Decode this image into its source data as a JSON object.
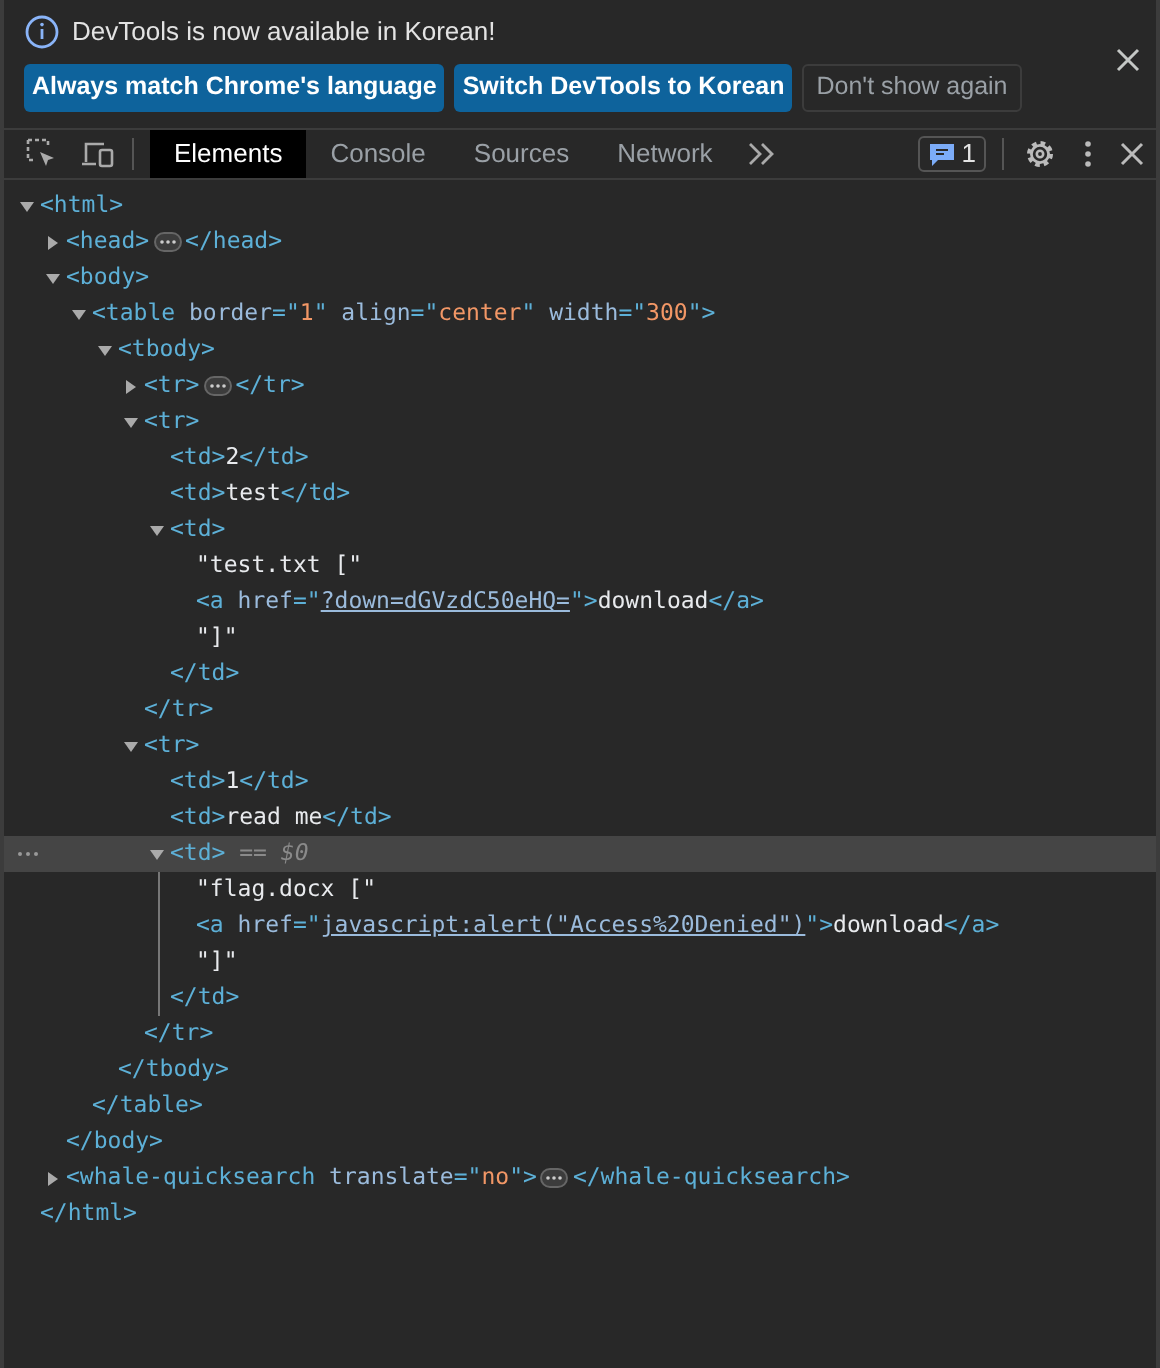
{
  "infobar": {
    "message": "DevTools is now available in Korean!",
    "buttons": [
      {
        "label": "Always match Chrome's language",
        "kind": "primary"
      },
      {
        "label": "Switch DevTools to Korean",
        "kind": "primary"
      },
      {
        "label": "Don't show again",
        "kind": "plain"
      }
    ]
  },
  "toolbar": {
    "tabs": [
      {
        "label": "Elements",
        "selected": true
      },
      {
        "label": "Console",
        "selected": false
      },
      {
        "label": "Sources",
        "selected": false
      },
      {
        "label": "Network",
        "selected": false
      }
    ],
    "issues_count": "1"
  },
  "tree": [
    {
      "selected": false,
      "expanded": true,
      "parts": [
        {
          "kind": "tag",
          "text": "<html>"
        }
      ],
      "close": [
        {
          "kind": "tag",
          "text": "</html>"
        }
      ],
      "children": [
        {
          "selected": false,
          "expanded": false,
          "parts": [
            {
              "kind": "tag",
              "text": "<head>"
            },
            {
              "kind": "ellipsis"
            },
            {
              "kind": "tag",
              "text": "</head>"
            }
          ]
        },
        {
          "selected": false,
          "expanded": true,
          "parts": [
            {
              "kind": "tag",
              "text": "<body>"
            }
          ],
          "close": [
            {
              "kind": "tag",
              "text": "</body>"
            }
          ],
          "children": [
            {
              "selected": false,
              "expanded": true,
              "parts": [
                {
                  "kind": "tag",
                  "text": "<table"
                },
                {
                  "kind": "attr",
                  "text": " border"
                },
                {
                  "kind": "tag",
                  "text": "=\""
                },
                {
                  "kind": "value",
                  "text": "1"
                },
                {
                  "kind": "tag",
                  "text": "\""
                },
                {
                  "kind": "attr",
                  "text": " align"
                },
                {
                  "kind": "tag",
                  "text": "=\""
                },
                {
                  "kind": "value",
                  "text": "center"
                },
                {
                  "kind": "tag",
                  "text": "\""
                },
                {
                  "kind": "attr",
                  "text": " width"
                },
                {
                  "kind": "tag",
                  "text": "=\""
                },
                {
                  "kind": "value",
                  "text": "300"
                },
                {
                  "kind": "tag",
                  "text": "\">"
                }
              ],
              "close": [
                {
                  "kind": "tag",
                  "text": "</table>"
                }
              ],
              "children": [
                {
                  "selected": false,
                  "expanded": true,
                  "parts": [
                    {
                      "kind": "tag",
                      "text": "<tbody>"
                    }
                  ],
                  "close": [
                    {
                      "kind": "tag",
                      "text": "</tbody>"
                    }
                  ],
                  "children": [
                    {
                      "selected": false,
                      "expanded": false,
                      "parts": [
                        {
                          "kind": "tag",
                          "text": "<tr>"
                        },
                        {
                          "kind": "ellipsis"
                        },
                        {
                          "kind": "tag",
                          "text": "</tr>"
                        }
                      ]
                    },
                    {
                      "selected": false,
                      "expanded": true,
                      "parts": [
                        {
                          "kind": "tag",
                          "text": "<tr>"
                        }
                      ],
                      "close": [
                        {
                          "kind": "tag",
                          "text": "</tr>"
                        }
                      ],
                      "children": [
                        {
                          "selected": false,
                          "parts": [
                            {
                              "kind": "tag",
                              "text": "<td>"
                            },
                            {
                              "kind": "text",
                              "text": "2"
                            },
                            {
                              "kind": "tag",
                              "text": "</td>"
                            }
                          ]
                        },
                        {
                          "selected": false,
                          "parts": [
                            {
                              "kind": "tag",
                              "text": "<td>"
                            },
                            {
                              "kind": "text",
                              "text": "test"
                            },
                            {
                              "kind": "tag",
                              "text": "</td>"
                            }
                          ]
                        },
                        {
                          "selected": false,
                          "expanded": true,
                          "parts": [
                            {
                              "kind": "tag",
                              "text": "<td>"
                            }
                          ],
                          "close": [
                            {
                              "kind": "tag",
                              "text": "</td>"
                            }
                          ],
                          "children": [
                            {
                              "selected": false,
                              "parts": [
                                {
                                  "kind": "text",
                                  "text": "\"test.txt [\""
                                }
                              ]
                            },
                            {
                              "selected": false,
                              "parts": [
                                {
                                  "kind": "tag",
                                  "text": "<a"
                                },
                                {
                                  "kind": "attr",
                                  "text": " href"
                                },
                                {
                                  "kind": "tag",
                                  "text": "=\""
                                },
                                {
                                  "kind": "link",
                                  "text": "?down=dGVzdC50eHQ="
                                },
                                {
                                  "kind": "tag",
                                  "text": "\">"
                                },
                                {
                                  "kind": "text",
                                  "text": "download"
                                },
                                {
                                  "kind": "tag",
                                  "text": "</a>"
                                }
                              ]
                            },
                            {
                              "selected": false,
                              "parts": [
                                {
                                  "kind": "text",
                                  "text": "\"]\""
                                }
                              ]
                            }
                          ]
                        }
                      ]
                    },
                    {
                      "selected": false,
                      "expanded": true,
                      "parts": [
                        {
                          "kind": "tag",
                          "text": "<tr>"
                        }
                      ],
                      "close": [
                        {
                          "kind": "tag",
                          "text": "</tr>"
                        }
                      ],
                      "children": [
                        {
                          "selected": false,
                          "parts": [
                            {
                              "kind": "tag",
                              "text": "<td>"
                            },
                            {
                              "kind": "text",
                              "text": "1"
                            },
                            {
                              "kind": "tag",
                              "text": "</td>"
                            }
                          ]
                        },
                        {
                          "selected": false,
                          "parts": [
                            {
                              "kind": "tag",
                              "text": "<td>"
                            },
                            {
                              "kind": "text",
                              "text": "read me"
                            },
                            {
                              "kind": "tag",
                              "text": "</td>"
                            }
                          ]
                        },
                        {
                          "selected": true,
                          "expanded": true,
                          "parts": [
                            {
                              "kind": "tag",
                              "text": "<td>"
                            },
                            {
                              "kind": "hint",
                              "text": " == $0"
                            }
                          ],
                          "close": [
                            {
                              "kind": "tag",
                              "text": "</td>"
                            }
                          ],
                          "children": [
                            {
                              "selected": false,
                              "parts": [
                                {
                                  "kind": "text",
                                  "text": "\"flag.docx [\""
                                }
                              ]
                            },
                            {
                              "selected": false,
                              "parts": [
                                {
                                  "kind": "tag",
                                  "text": "<a"
                                },
                                {
                                  "kind": "attr",
                                  "text": " href"
                                },
                                {
                                  "kind": "tag",
                                  "text": "=\""
                                },
                                {
                                  "kind": "link",
                                  "text": "javascript:alert(\"Access%20Denied\")"
                                },
                                {
                                  "kind": "tag",
                                  "text": "\">"
                                },
                                {
                                  "kind": "text",
                                  "text": "download"
                                },
                                {
                                  "kind": "tag",
                                  "text": "</a>"
                                }
                              ]
                            },
                            {
                              "selected": false,
                              "parts": [
                                {
                                  "kind": "text",
                                  "text": "\"]\""
                                }
                              ]
                            }
                          ]
                        }
                      ]
                    }
                  ]
                }
              ]
            }
          ]
        },
        {
          "selected": false,
          "expanded": false,
          "parts": [
            {
              "kind": "tag",
              "text": "<whale-quicksearch"
            },
            {
              "kind": "attr",
              "text": " translate"
            },
            {
              "kind": "tag",
              "text": "=\""
            },
            {
              "kind": "value",
              "text": "no"
            },
            {
              "kind": "tag",
              "text": "\">"
            },
            {
              "kind": "ellipsis"
            },
            {
              "kind": "tag",
              "text": "</whale-quicksearch>"
            }
          ]
        }
      ]
    }
  ]
}
